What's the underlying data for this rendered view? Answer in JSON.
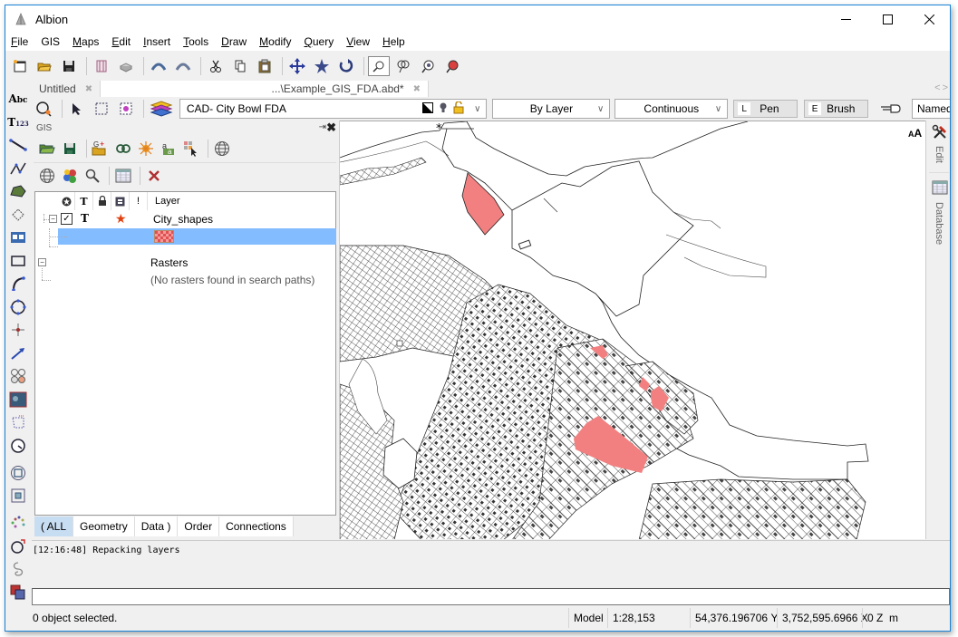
{
  "window": {
    "title": "Albion",
    "controls": {
      "minimize": "—",
      "maximize": "☐",
      "close": "✕"
    }
  },
  "menubar": {
    "items": [
      {
        "label": "File",
        "accel": "F"
      },
      {
        "label": "GIS",
        "accel": ""
      },
      {
        "label": "Maps",
        "accel": "M"
      },
      {
        "label": "Edit",
        "accel": "E"
      },
      {
        "label": "Insert",
        "accel": "I"
      },
      {
        "label": "Tools",
        "accel": "T"
      },
      {
        "label": "Draw",
        "accel": "D"
      },
      {
        "label": "Modify",
        "accel": "M"
      },
      {
        "label": "Query",
        "accel": "Q"
      },
      {
        "label": "View",
        "accel": "V"
      },
      {
        "label": "Help",
        "accel": "H"
      }
    ]
  },
  "main_toolbar": {
    "buttons": [
      "new-file-icon",
      "open-folder-icon",
      "save-icon",
      "page-setup-icon",
      "print-icon",
      "undo-icon",
      "redo-icon",
      "cut-icon",
      "copy-icon",
      "paste-icon",
      "pan-icon",
      "zoom-extents-icon",
      "regen-icon",
      "zoom-window-icon",
      "zoom-lasso-icon",
      "zoom-realtime-icon",
      "zoom-previous-icon"
    ]
  },
  "left_tools": {
    "items": [
      {
        "name": "text-tool-icon",
        "glyph": "Aᵇᶜ"
      },
      {
        "name": "numbered-text-tool-icon",
        "glyph": "T₁₂₃"
      }
    ]
  },
  "doc_tabs": [
    {
      "label": "Untitled",
      "close": "✖"
    },
    {
      "label": "...\\Example_GIS_FDA.abd*",
      "close": "✖"
    }
  ],
  "tab_nav": {
    "prev": "<",
    "next": ">"
  },
  "layer_bar": {
    "current_layer": "CAD- City Bowl FDA",
    "color_combo": "By Layer",
    "linetype_combo": "Continuous",
    "pen": {
      "key": "L",
      "label": "Pen"
    },
    "brush": {
      "key": "E",
      "label": "Brush"
    },
    "named_combo": "Named"
  },
  "gis_panel": {
    "title": "GIS",
    "pin": "⇥",
    "close": "✖",
    "tree": {
      "header": {
        "layer_col": "Layer",
        "bang_col": "!"
      },
      "layer": {
        "name": "City_shapes",
        "visible": true,
        "checked": "✓",
        "text_icon": "T",
        "star": "★"
      },
      "rasters": {
        "name": "Rasters",
        "message": "(No rasters found in search paths)"
      }
    },
    "bottom_tabs": [
      {
        "label": "( ALL",
        "active": true
      },
      {
        "label": "Geometry",
        "active": false
      },
      {
        "label": "Data )",
        "active": false
      },
      {
        "label": "Order",
        "active": false
      },
      {
        "label": "Connections",
        "active": false
      }
    ]
  },
  "right_rail": {
    "edit_label": "Edit",
    "database_label": "Database",
    "font_size_label": "AA"
  },
  "map": {
    "highlight_color": "#f28080",
    "line_color": "#111111"
  },
  "log": {
    "lines": [
      "[12:16:48] Repacking layers"
    ]
  },
  "command_input": {
    "value": ""
  },
  "statusbar": {
    "selection": "0 object selected.",
    "space": "Model",
    "scale": "1:28,153",
    "y_coord": "54,376.196706",
    "y_label": "Y",
    "x_coord": "3,752,595.6966",
    "x_label": "X",
    "z_coord": "0",
    "z_label": "Z",
    "units": "m"
  }
}
